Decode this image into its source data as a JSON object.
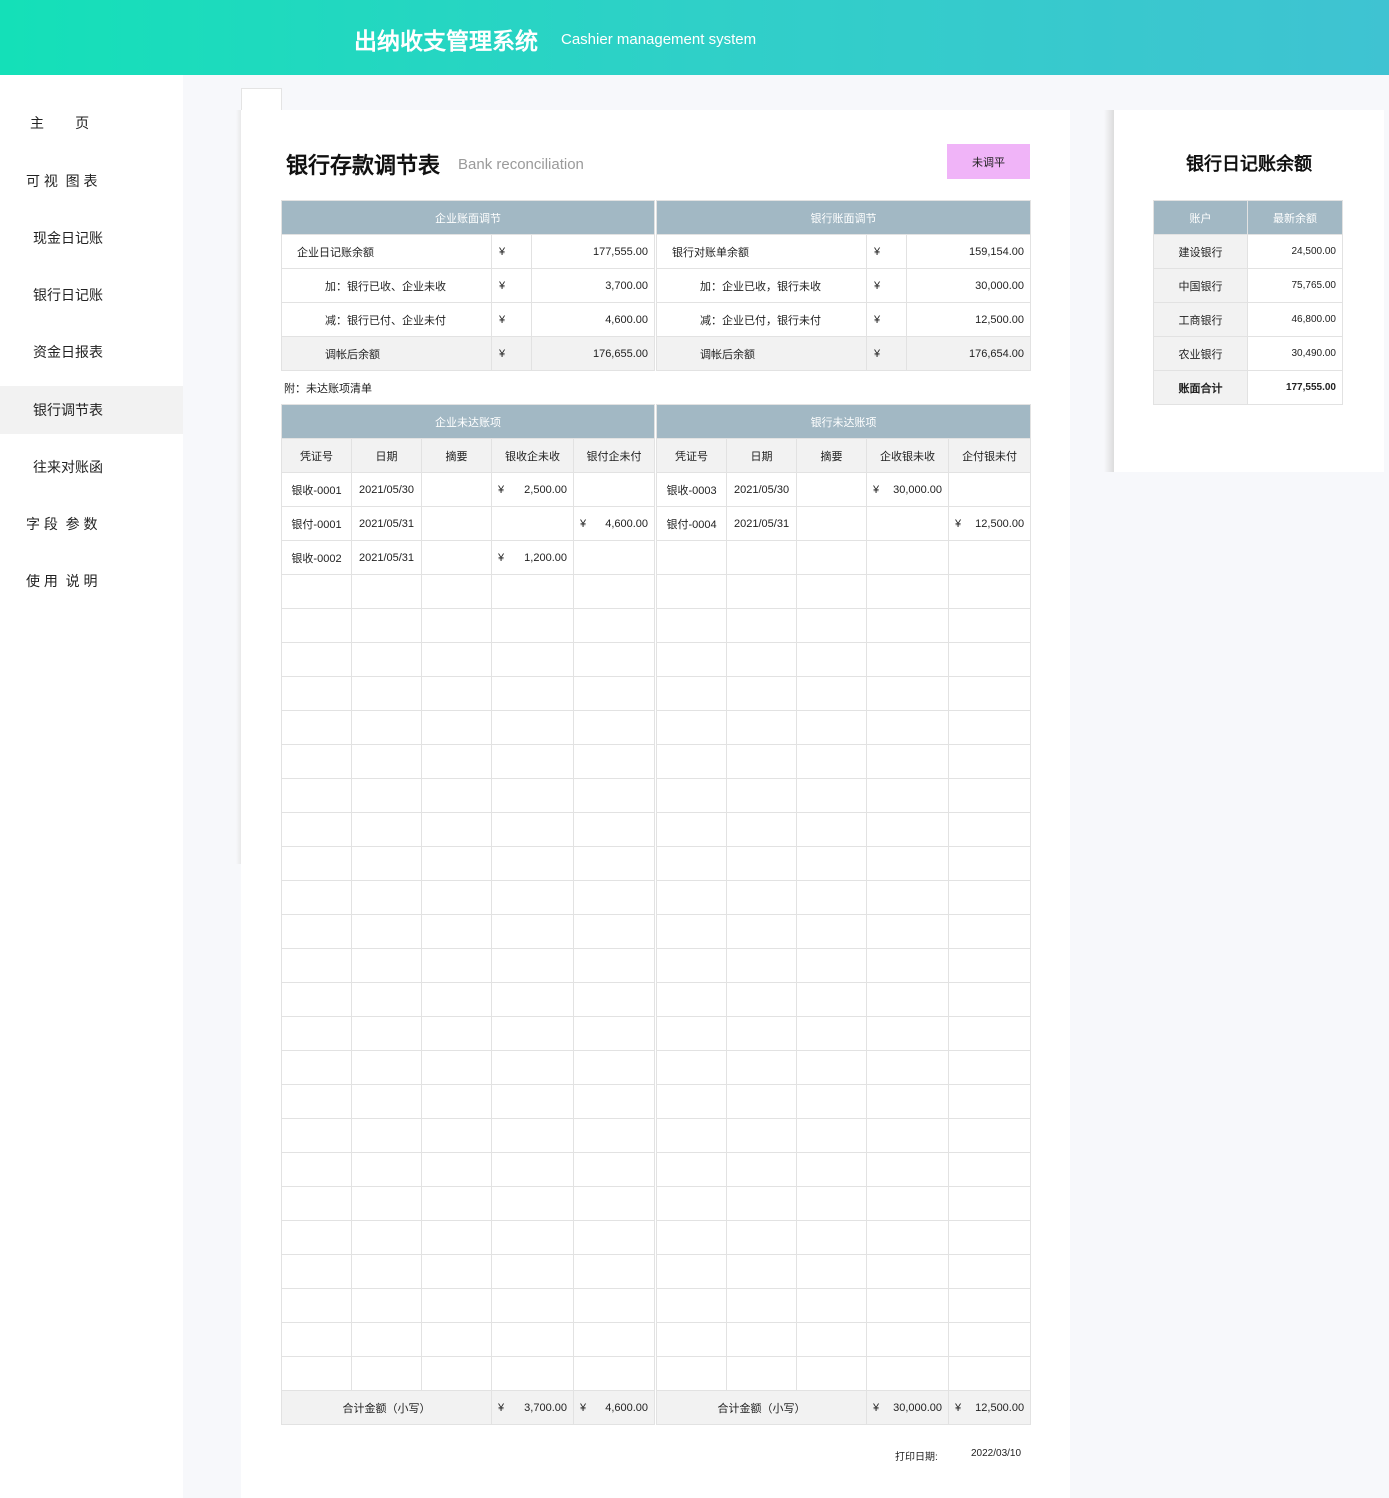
{
  "header": {
    "title": "出纳收支管理系统",
    "subtitle": "Cashier management system"
  },
  "sidebar": {
    "items": [
      {
        "label": "主        页"
      },
      {
        "label": "可 视  图 表"
      },
      {
        "label": "现金日记账"
      },
      {
        "label": "银行日记账"
      },
      {
        "label": "资金日报表"
      },
      {
        "label": "银行调节表",
        "active": true
      },
      {
        "label": "往来对账函"
      },
      {
        "label": "字 段  参 数"
      },
      {
        "label": "使 用  说 明"
      }
    ]
  },
  "page": {
    "title": "银行存款调节表",
    "subtitle": "Bank reconciliation",
    "status": "未调平",
    "status_color": "#f0b4f8"
  },
  "reconciliation": {
    "left_header": "企业账面调节",
    "right_header": "银行账面调节",
    "currency": "¥",
    "rows": [
      {
        "left_label": "企业日记账余额",
        "left_amount": "177,555.00",
        "right_label": "银行对账单余额",
        "right_amount": "159,154.00"
      },
      {
        "left_label": "加：银行已收、企业未收",
        "left_amount": "3,700.00",
        "right_label": "加：企业已收，银行未收",
        "right_amount": "30,000.00"
      },
      {
        "left_label": "减：银行已付、企业未付",
        "left_amount": "4,600.00",
        "right_label": "减：企业已付，银行未付",
        "right_amount": "12,500.00"
      },
      {
        "left_label": "调帐后余额",
        "left_amount": "176,655.00",
        "right_label": "调帐后余额",
        "right_amount": "176,654.00"
      }
    ]
  },
  "attachment_label": "附：未达账项清单",
  "outstanding": {
    "left_header": "企业未达账项",
    "right_header": "银行未达账项",
    "left_columns": [
      "凭证号",
      "日期",
      "摘要",
      "银收企未收",
      "银付企未付"
    ],
    "right_columns": [
      "凭证号",
      "日期",
      "摘要",
      "企收银未收",
      "企付银未付"
    ],
    "currency": "¥",
    "left_rows": [
      {
        "voucher": "银收-0001",
        "date": "2021/05/30",
        "memo": "",
        "col1": "2,500.00",
        "col2": ""
      },
      {
        "voucher": "银付-0001",
        "date": "2021/05/31",
        "memo": "",
        "col1": "",
        "col2": "4,600.00"
      },
      {
        "voucher": "银收-0002",
        "date": "2021/05/31",
        "memo": "",
        "col1": "1,200.00",
        "col2": ""
      }
    ],
    "right_rows": [
      {
        "voucher": "银收-0003",
        "date": "2021/05/30",
        "memo": "",
        "col1": "30,000.00",
        "col2": ""
      },
      {
        "voucher": "银付-0004",
        "date": "2021/05/31",
        "memo": "",
        "col1": "",
        "col2": "12,500.00"
      }
    ],
    "total_label": "合计金额（小写）",
    "left_total_1": "3,700.00",
    "left_total_2": "4,600.00",
    "right_total_1": "30,000.00",
    "right_total_2": "12,500.00"
  },
  "print": {
    "label": "打印日期:",
    "date": "2022/03/10"
  },
  "balances": {
    "title": "银行日记账余额",
    "columns": [
      "账户",
      "最新余额"
    ],
    "rows": [
      {
        "name": "建设银行",
        "amount": "24,500.00"
      },
      {
        "name": "中国银行",
        "amount": "75,765.00"
      },
      {
        "name": "工商银行",
        "amount": "46,800.00"
      },
      {
        "name": "农业银行",
        "amount": "30,490.00"
      }
    ],
    "total_label": "账面合计",
    "total_amount": "177,555.00"
  }
}
